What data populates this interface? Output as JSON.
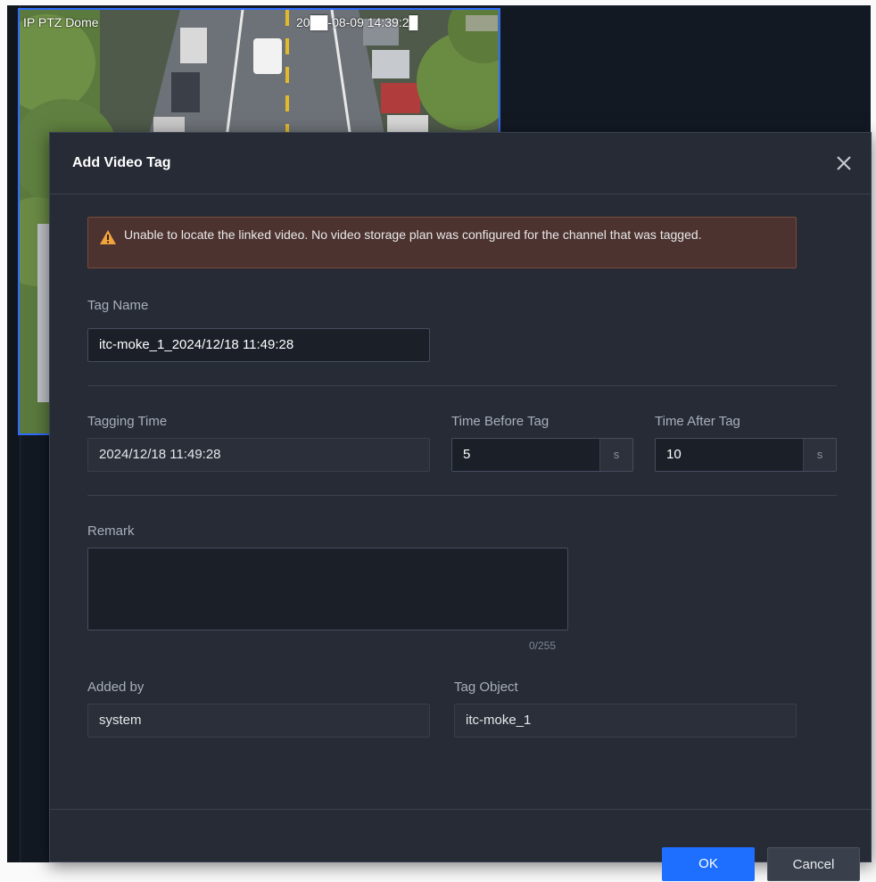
{
  "video": {
    "camera_label": "IP PTZ Dome",
    "osd_time": "20██-08-09 14:39:2█"
  },
  "dialog": {
    "title": "Add Video Tag",
    "warning": "Unable to locate the linked video. No video storage plan was configured for the channel that was tagged.",
    "tag_name": {
      "label": "Tag Name",
      "value": "itc-moke_1_2024/12/18 11:49:28"
    },
    "tagging_time": {
      "label": "Tagging Time",
      "value": "2024/12/18 11:49:28"
    },
    "time_before": {
      "label": "Time Before Tag",
      "value": "5",
      "unit": "s"
    },
    "time_after": {
      "label": "Time After Tag",
      "value": "10",
      "unit": "s"
    },
    "remark": {
      "label": "Remark",
      "value": "",
      "counter": "0/255"
    },
    "added_by": {
      "label": "Added by",
      "value": "system"
    },
    "tag_object": {
      "label": "Tag Object",
      "value": "itc-moke_1"
    },
    "ok_label": "OK",
    "cancel_label": "Cancel"
  },
  "colors": {
    "accent": "#1e6fff",
    "warning_bg": "#4c3330",
    "warning_icon": "#f3a33c",
    "dialog_bg": "#262b35"
  }
}
